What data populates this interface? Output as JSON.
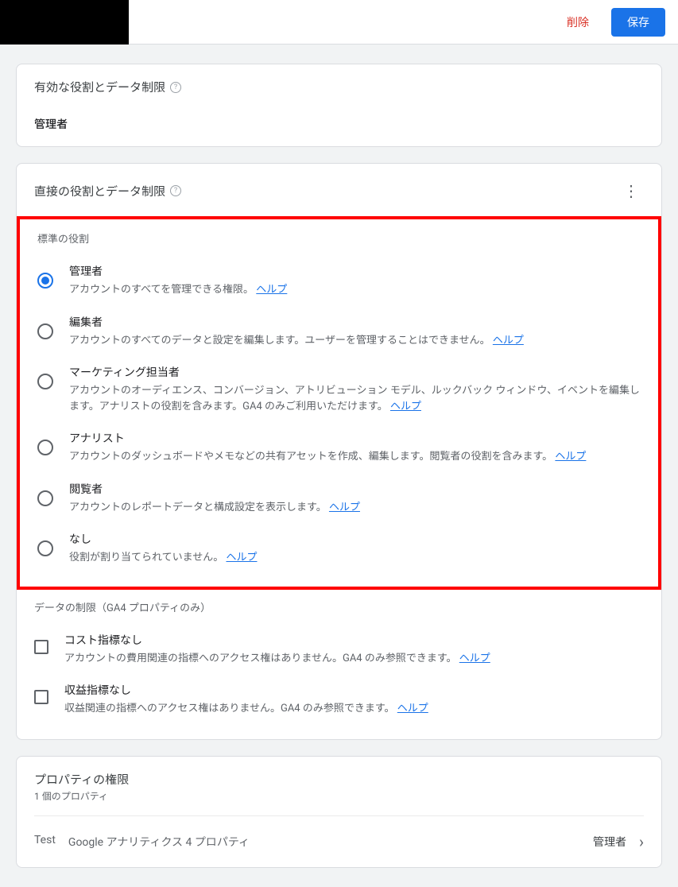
{
  "topbar": {
    "delete_label": "削除",
    "save_label": "保存"
  },
  "effective": {
    "title": "有効な役割とデータ制限",
    "value": "管理者"
  },
  "direct": {
    "title": "直接の役割とデータ制限",
    "standard_roles_title": "標準の役割",
    "roles": [
      {
        "name": "管理者",
        "desc": "アカウントのすべてを管理できる権限。",
        "help": "ヘルプ",
        "selected": true
      },
      {
        "name": "編集者",
        "desc": "アカウントのすべてのデータと設定を編集します。ユーザーを管理することはできません。",
        "help": "ヘルプ",
        "selected": false
      },
      {
        "name": "マーケティング担当者",
        "desc": "アカウントのオーディエンス、コンバージョン、アトリビューション モデル、ルックバック ウィンドウ、イベントを編集します。アナリストの役割を含みます。GA4 のみご利用いただけます。",
        "help": "ヘルプ",
        "selected": false
      },
      {
        "name": "アナリスト",
        "desc": "アカウントのダッシュボードやメモなどの共有アセットを作成、編集します。閲覧者の役割を含みます。",
        "help": "ヘルプ",
        "selected": false
      },
      {
        "name": "閲覧者",
        "desc": "アカウントのレポートデータと構成設定を表示します。",
        "help": "ヘルプ",
        "selected": false
      },
      {
        "name": "なし",
        "desc": "役割が割り当てられていません。",
        "help": "ヘルプ",
        "selected": false
      }
    ],
    "data_restrictions_title": "データの制限（GA4 プロパティのみ）",
    "restrictions": [
      {
        "name": "コスト指標なし",
        "desc": "アカウントの費用関連の指標へのアクセス権はありません。GA4 のみ参照できます。",
        "help": "ヘルプ"
      },
      {
        "name": "収益指標なし",
        "desc": "収益関連の指標へのアクセス権はありません。GA4 のみ参照できます。",
        "help": "ヘルプ"
      }
    ]
  },
  "property": {
    "title": "プロパティの権限",
    "count": "1 個のプロパティ",
    "item_label1": "Test",
    "item_label2": "Google アナリティクス 4 プロパティ",
    "item_role": "管理者"
  }
}
